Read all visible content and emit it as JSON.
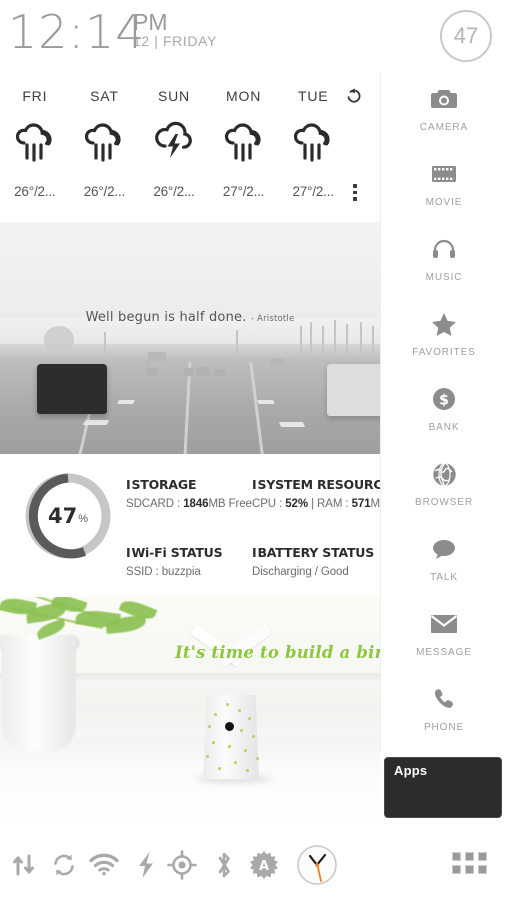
{
  "statusbar": {
    "time": "12:14",
    "ampm": "PM",
    "date": "12 | FRIDAY",
    "battery_percent": "47"
  },
  "weather": {
    "refresh_icon": "refresh-icon",
    "overflow_icon": "overflow-menu-icon",
    "days": [
      {
        "day": "FRI",
        "icon": "rain-icon",
        "temp": "26°/2..."
      },
      {
        "day": "SAT",
        "icon": "rain-icon",
        "temp": "26°/2..."
      },
      {
        "day": "SUN",
        "icon": "thunderstorm-icon",
        "temp": "26°/2..."
      },
      {
        "day": "MON",
        "icon": "rain-icon",
        "temp": "27°/2..."
      },
      {
        "day": "TUE",
        "icon": "rain-icon",
        "temp": "27°/2..."
      }
    ]
  },
  "quote_widget": {
    "text": "Well begun is half done.",
    "author": "- Aristotle"
  },
  "system_widget": {
    "ring_value": "47",
    "ring_unit": "%",
    "ring_fill_color": "#5a5a5a",
    "ring_track_color": "#c6c6c6",
    "cells": [
      {
        "title": "STORAGE",
        "value_prefix": "SDCARD : ",
        "value_strong": "1846",
        "value_suffix": "MB Free"
      },
      {
        "title": "SYSTEM RESOURCES",
        "value_prefix": "CPU : ",
        "value_strong": "52%",
        "value_mid": "  |  RAM : ",
        "value_strong2": "571",
        "value_suffix": "MB"
      },
      {
        "title": "Wi-Fi STATUS",
        "value_prefix": "SSID : ",
        "value_strong": "",
        "value_suffix": "buzzpia"
      },
      {
        "title": "BATTERY STATUS",
        "value_prefix": "Discharging  /  Good",
        "value_strong": "",
        "value_suffix": ""
      }
    ]
  },
  "photo_widget": {
    "text": "It's time to build a birdhouse",
    "text_color": "#8dc63f"
  },
  "sidebar": {
    "items": [
      {
        "label": "CAMERA",
        "icon": "camera-icon"
      },
      {
        "label": "MOVIE",
        "icon": "film-icon"
      },
      {
        "label": "MUSIC",
        "icon": "headphones-icon"
      },
      {
        "label": "FAVORITES",
        "icon": "star-icon"
      },
      {
        "label": "BANK",
        "icon": "dollar-circle-icon"
      },
      {
        "label": "BROWSER",
        "icon": "globe-icon"
      },
      {
        "label": "TALK",
        "icon": "speech-bubble-icon"
      },
      {
        "label": "MESSAGE",
        "icon": "envelope-icon"
      },
      {
        "label": "PHONE",
        "icon": "phone-icon"
      }
    ],
    "apps_panel_label": "Apps"
  },
  "dock": {
    "toggles": [
      {
        "name": "mobile-data-icon"
      },
      {
        "name": "sync-icon"
      },
      {
        "name": "wifi-icon"
      },
      {
        "name": "flash-icon"
      },
      {
        "name": "gps-icon"
      },
      {
        "name": "bluetooth-icon"
      },
      {
        "name": "auto-brightness-icon"
      },
      {
        "name": "clock-icon"
      }
    ],
    "app_drawer_icon": "app-drawer-icon"
  }
}
